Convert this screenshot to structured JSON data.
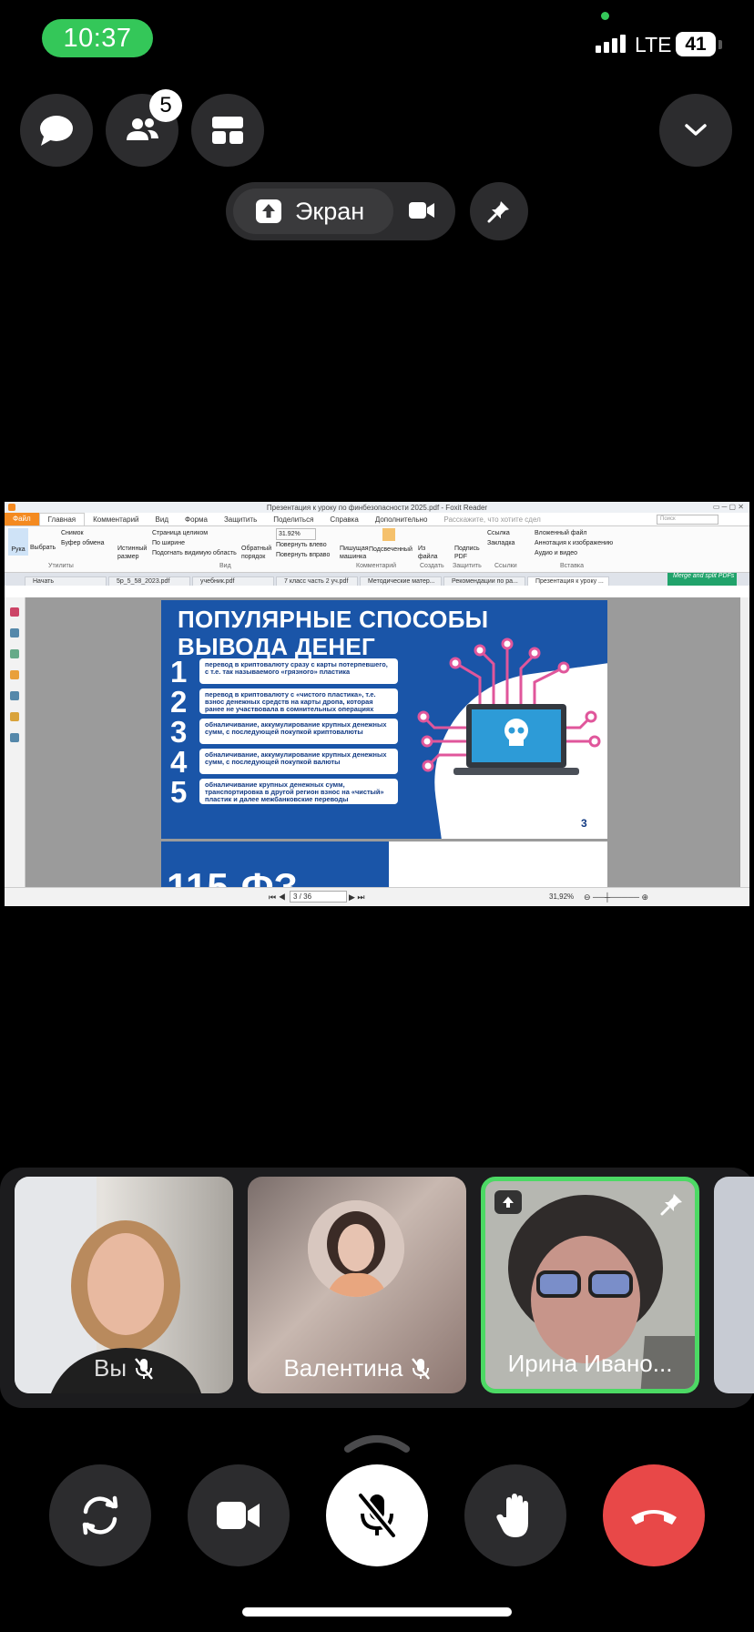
{
  "status_bar": {
    "time": "10:37",
    "network": "LTE",
    "battery": "41"
  },
  "top_controls": {
    "participants_count": "5",
    "screen_label": "Экран"
  },
  "shared_screen": {
    "window_title": "Презентация к уроку по финбезопасности 2025.pdf - Foxit Reader",
    "search_placeholder": "Поиск",
    "ribbon_tabs": [
      "Файл",
      "Главная",
      "Комментарий",
      "Вид",
      "Форма",
      "Защитить",
      "Поделиться",
      "Справка",
      "Дополнительно"
    ],
    "tell_me": "Расскажите, что хотите сдел",
    "ribbon": {
      "hand": "Рука",
      "select": "Выбрать",
      "snapshot": "Снимок",
      "clipboard": "Буфер обмена",
      "group_utilities": "Утилиты",
      "actual_size": "Истинный размер",
      "fit_page": "Страница целиком",
      "fit_width": "По ширине",
      "fit_visible": "Подогнать видимую область",
      "reverse": "Обратный порядок",
      "zoom": "31.92%",
      "rotate_left": "Повернуть влево",
      "rotate_right": "Повернуть вправо",
      "group_view": "Вид",
      "typewriter": "Пишущая машинка",
      "highlight": "Подсвеченный",
      "group_comment": "Комментарий",
      "from_file": "Из файла",
      "group_create": "Создать",
      "sign_pdf": "Подпись PDF",
      "group_protect": "Защитить",
      "link": "Ссылка",
      "bookmark": "Закладка",
      "group_links": "Ссылки",
      "embedded_file": "Вложенный файл",
      "image_annotation": "Аннотация к изображению",
      "audio_video": "Аудио и видео",
      "group_insert": "Вставка"
    },
    "doc_tabs": [
      "Начать",
      "5p_5_58_2023.pdf",
      "учебник.pdf",
      "7 класс часть 2 уч.pdf",
      "Методические матер...",
      "Рекомендации по ра...",
      "Презентация к уроку ..."
    ],
    "merge_banner": "Merge and split PDFs",
    "slide": {
      "title_line1": "ПОПУЛЯРНЫЕ СПОСОБЫ",
      "title_line2": "ВЫВОДА ДЕНЕГ",
      "items": [
        {
          "num": "1",
          "text": "перевод в криптовалюту сразу с карты потерпевшего, с т.е. так называемого «грязного» пластика"
        },
        {
          "num": "2",
          "text": "перевод в криптовалюту с «чистого пластика», т.е. взнос денежных средств на карты дропа, которая ранее не участвовала в сомнительных операциях"
        },
        {
          "num": "3",
          "text": "обналичивание, аккумулирование крупных денежных сумм, с последующей покупкой криптовалюты"
        },
        {
          "num": "4",
          "text": "обналичивание, аккумулирование крупных денежных сумм, с последующей покупкой валюты"
        },
        {
          "num": "5",
          "text": "обналичивание крупных денежных сумм, транспортировка в другой регион взнос на «чистый» пластик и далее межбанковские переводы"
        }
      ],
      "page_number": "3"
    },
    "next_slide_title": "115-ФЗ",
    "page_indicator": "3 / 36",
    "zoom_status": "31,92%"
  },
  "participants": [
    {
      "name": "Вы",
      "muted": true
    },
    {
      "name": "Валентина",
      "muted": true
    },
    {
      "name": "Ирина Ивано..."
    }
  ]
}
